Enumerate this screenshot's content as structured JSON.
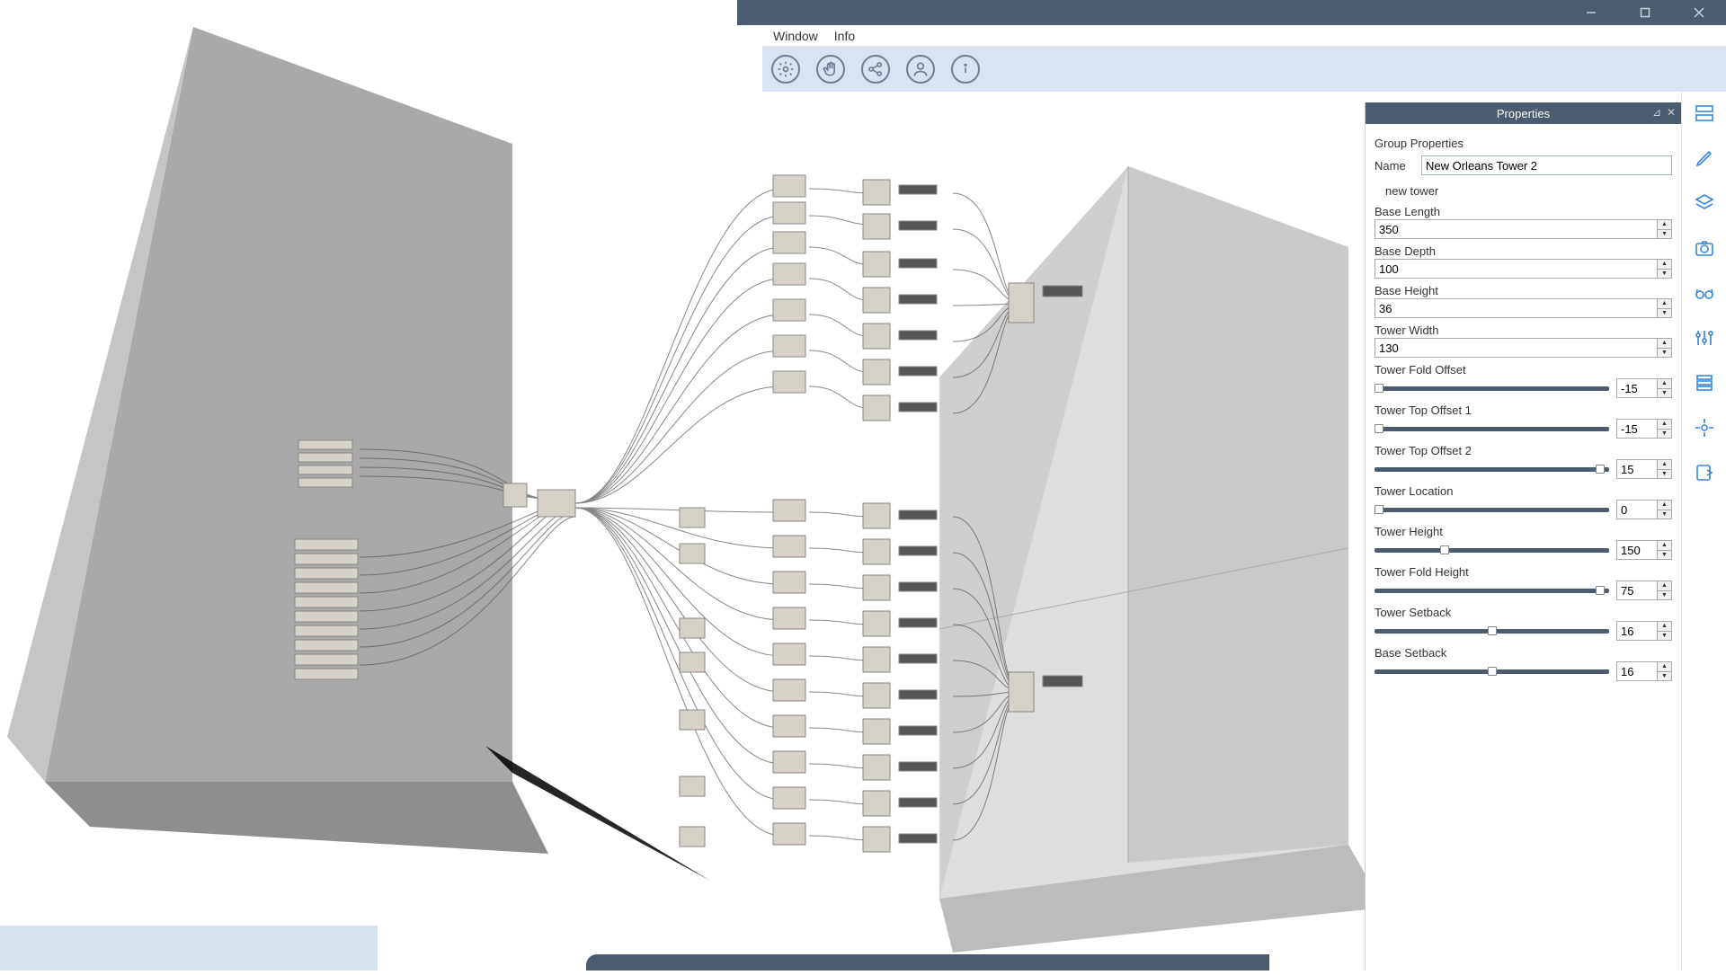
{
  "titlebar": {},
  "menu": {
    "window": "Window",
    "info": "Info"
  },
  "toolbar_icons": [
    "gear-icon",
    "hand-icon",
    "share-icon",
    "person-icon",
    "info-icon"
  ],
  "properties": {
    "title": "Properties",
    "group_label": "Group Properties",
    "name_label": "Name",
    "name_value": "New Orleans Tower 2",
    "subtitle": "new tower",
    "fields": [
      {
        "label": "Base Length",
        "value": "350",
        "kind": "number"
      },
      {
        "label": "Base Depth",
        "value": "100",
        "kind": "number"
      },
      {
        "label": "Base Height",
        "value": "36",
        "kind": "number"
      },
      {
        "label": "Tower Width",
        "value": "130",
        "kind": "number"
      },
      {
        "label": "Tower Fold Offset",
        "value": "-15",
        "kind": "slider",
        "pos": 0.02
      },
      {
        "label": "Tower Top Offset 1",
        "value": "-15",
        "kind": "slider",
        "pos": 0.02
      },
      {
        "label": "Tower Top Offset 2",
        "value": "15",
        "kind": "slider",
        "pos": 0.96
      },
      {
        "label": "Tower Location",
        "value": "0",
        "kind": "slider",
        "pos": 0.02
      },
      {
        "label": "Tower Height",
        "value": "150",
        "kind": "slider",
        "pos": 0.3
      },
      {
        "label": "Tower Fold Height",
        "value": "75",
        "kind": "slider",
        "pos": 0.96
      },
      {
        "label": "Tower Setback",
        "value": "16",
        "kind": "slider",
        "pos": 0.5
      },
      {
        "label": "Base Setback",
        "value": "16",
        "kind": "slider",
        "pos": 0.5
      }
    ]
  }
}
